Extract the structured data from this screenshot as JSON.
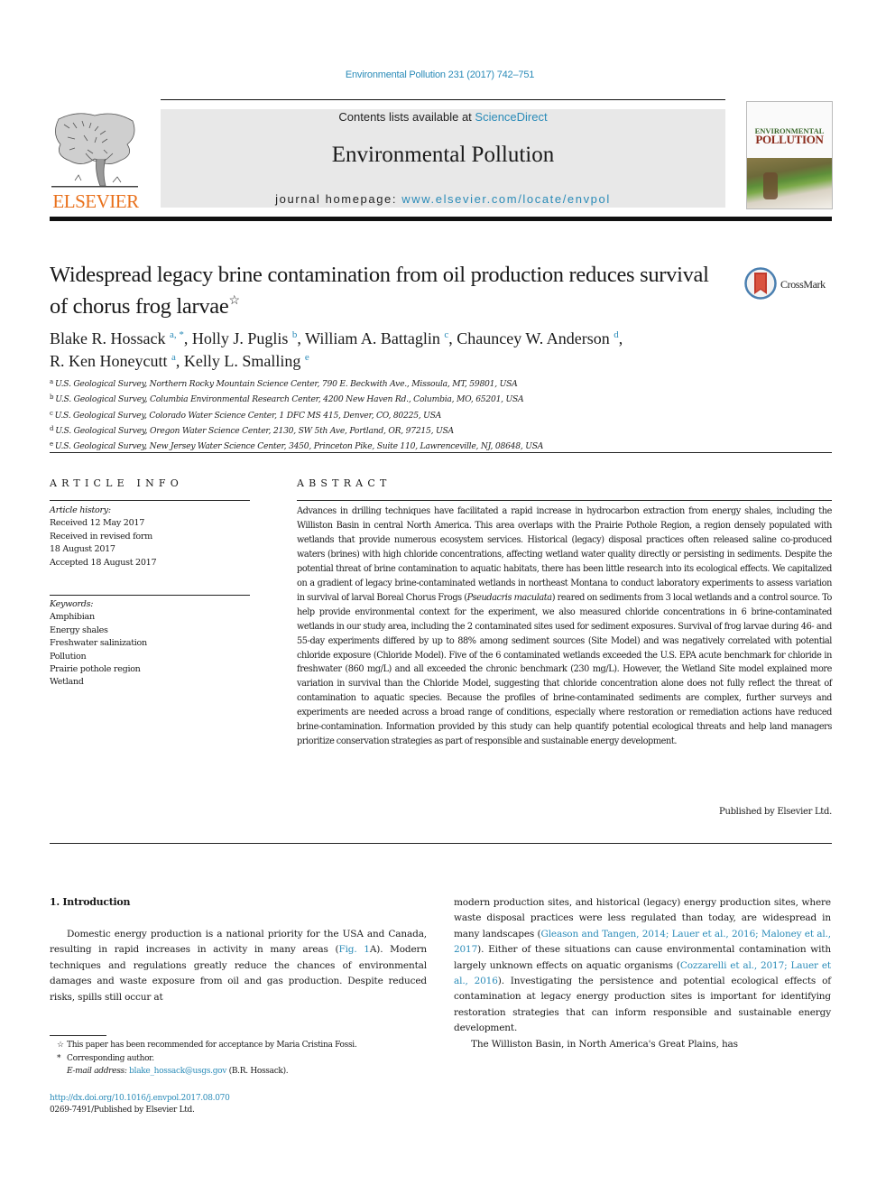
{
  "header": {
    "citation": "Environmental Pollution 231 (2017) 742–751",
    "contents_prefix": "Contents lists available at ",
    "contents_link": "ScienceDirect",
    "journal_title": "Environmental Pollution",
    "homepage_prefix": "journal homepage: ",
    "homepage_link": "www.elsevier.com/locate/envpol",
    "publisher_logo_text": "ELSEVIER",
    "cover_title_line1": "ENVIRONMENTAL",
    "cover_title_line2": "POLLUTION",
    "logo_color": "#e9711c",
    "link_color": "#2a8bb8"
  },
  "article": {
    "title": "Widespread legacy brine contamination from oil production reduces survival of chorus frog larvae",
    "title_mark": "☆",
    "crossmark_label": "CrossMark",
    "authors": [
      {
        "name": "Blake R. Hossack",
        "sup": "a, *",
        "sep": ", "
      },
      {
        "name": "Holly J. Puglis",
        "sup": "b",
        "sep": ", "
      },
      {
        "name": "William A. Battaglin",
        "sup": "c",
        "sep": ", "
      },
      {
        "name": "Chauncey W. Anderson",
        "sup": "d",
        "sep": ","
      },
      {
        "name": "R. Ken Honeycutt",
        "sup": "a",
        "sep": ", "
      },
      {
        "name": "Kelly L. Smalling",
        "sup": "e",
        "sep": ""
      }
    ],
    "affiliations": [
      {
        "key": "a",
        "text": "U.S. Geological Survey, Northern Rocky Mountain Science Center, 790 E. Beckwith Ave., Missoula, MT, 59801, USA"
      },
      {
        "key": "b",
        "text": "U.S. Geological Survey, Columbia Environmental Research Center, 4200 New Haven Rd., Columbia, MO, 65201, USA"
      },
      {
        "key": "c",
        "text": "U.S. Geological Survey, Colorado Water Science Center, 1 DFC MS 415, Denver, CO, 80225, USA"
      },
      {
        "key": "d",
        "text": "U.S. Geological Survey, Oregon Water Science Center, 2130, SW 5th Ave, Portland, OR, 97215, USA"
      },
      {
        "key": "e",
        "text": "U.S. Geological Survey, New Jersey Water Science Center, 3450, Princeton Pike, Suite 110, Lawrenceville, NJ, 08648, USA"
      }
    ]
  },
  "article_info": {
    "heading": "ARTICLE INFO",
    "history_label": "Article history:",
    "history": [
      "Received 12 May 2017",
      "Received in revised form",
      "18 August 2017",
      "Accepted 18 August 2017"
    ],
    "keywords_label": "Keywords:",
    "keywords": [
      "Amphibian",
      "Energy shales",
      "Freshwater salinization",
      "Pollution",
      "Prairie pothole region",
      "Wetland"
    ]
  },
  "abstract": {
    "heading": "ABSTRACT",
    "text_part1": "Advances in drilling techniques have facilitated a rapid increase in hydrocarbon extraction from energy shales, including the Williston Basin in central North America. This area overlaps with the Prairie Pothole Region, a region densely populated with wetlands that provide numerous ecosystem services. Historical (legacy) disposal practices often released saline co-produced waters (brines) with high chloride concentrations, affecting wetland water quality directly or persisting in sediments. Despite the potential threat of brine contamination to aquatic habitats, there has been little research into its ecological effects. We capitalized on a gradient of legacy brine-contaminated wetlands in northeast Montana to conduct laboratory experiments to assess variation in survival of larval Boreal Chorus Frogs (",
    "species": "Pseudacris maculata",
    "text_part2": ") reared on sediments from 3 local wetlands and a control source. To help provide environmental context for the experiment, we also measured chloride concentrations in 6 brine-contaminated wetlands in our study area, including the 2 contaminated sites used for sediment exposures. Survival of frog larvae during 46- and 55-day experiments differed by up to 88% among sediment sources (Site Model) and was negatively correlated with potential chloride exposure (Chloride Model). Five of the 6 contaminated wetlands exceeded the U.S. EPA acute benchmark for chloride in freshwater (860 mg/L) and all exceeded the chronic benchmark (230 mg/L). However, the Wetland Site model explained more variation in survival than the Chloride Model, suggesting that chloride concentration alone does not fully reflect the threat of contamination to aquatic species. Because the profiles of brine-contaminated sediments are complex, further surveys and experiments are needed across a broad range of conditions, especially where restoration or remediation actions have reduced brine-contamination. Information provided by this study can help quantify potential ecological threats and help land managers prioritize conservation strategies as part of responsible and sustainable energy development.",
    "published_by": "Published by Elsevier Ltd."
  },
  "body": {
    "intro_heading": "1.  Introduction",
    "left_p1_a": "Domestic energy production is a national priority for the USA and Canada, resulting in rapid increases in activity in many areas (",
    "left_p1_link": "Fig. 1",
    "left_p1_b": "A). Modern techniques and regulations greatly reduce the chances of environmental damages and waste exposure from oil and gas production. Despite reduced risks, spills still occur at",
    "right_p1_a": "modern production sites, and historical (legacy) energy production sites, where waste disposal practices were less regulated than today, are widespread in many landscapes (",
    "right_p1_link1": "Gleason and Tangen, 2014; Lauer et al., 2016; Maloney et al., 2017",
    "right_p1_b": "). Either of these situations can cause environmental contamination with largely unknown effects on aquatic organisms (",
    "right_p1_link2": "Cozzarelli et al., 2017; Lauer et al., 2016",
    "right_p1_c": "). Investigating the persistence and potential ecological effects of contamination at legacy energy production sites is important for identifying restoration strategies that can inform responsible and sustainable energy development.",
    "right_p2": "The Williston Basin, in North America's Great Plains, has"
  },
  "footnotes": {
    "fn1_mark": "☆",
    "fn1": "This paper has been recommended for acceptance by Maria Cristina Fossi.",
    "fn2_mark": "*",
    "fn2": "Corresponding author.",
    "email_label": "E-mail address: ",
    "email": "blake_hossack@usgs.gov",
    "email_suffix": " (B.R. Hossack).",
    "doi": "http://dx.doi.org/10.1016/j.envpol.2017.08.070",
    "issn": "0269-7491/Published by Elsevier Ltd."
  }
}
